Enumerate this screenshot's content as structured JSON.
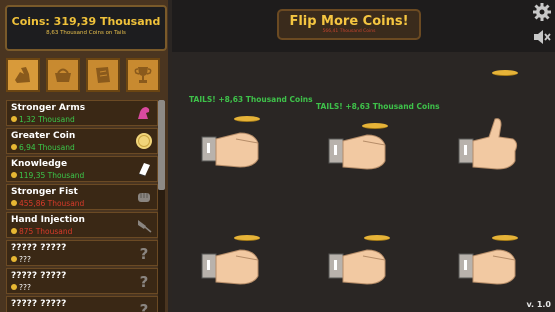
{
  "coins": {
    "total_label": "Coins: 319,39 Thousand",
    "rate_label": "8,63 Thousand Coins on Tails"
  },
  "tabs": [
    {
      "name": "upgrades",
      "icon": "arm-icon"
    },
    {
      "name": "shop",
      "icon": "basket-icon"
    },
    {
      "name": "map",
      "icon": "map-icon"
    },
    {
      "name": "trophies",
      "icon": "trophy-icon"
    }
  ],
  "upgrades": [
    {
      "name": "Stronger Arms",
      "cost": "1,32 Thousand",
      "cost_color": "green",
      "icon": "flexed-arm-icon"
    },
    {
      "name": "Greater Coin",
      "cost": "6,94 Thousand",
      "cost_color": "green",
      "icon": "coin-icon"
    },
    {
      "name": "Knowledge",
      "cost": "119,35 Thousand",
      "cost_color": "green",
      "icon": "book-icon"
    },
    {
      "name": "Stronger Fist",
      "cost": "455,86 Thousand",
      "cost_color": "red",
      "icon": "fist-icon"
    },
    {
      "name": "Hand Injection",
      "cost": "875 Thousand",
      "cost_color": "red",
      "icon": "syringe-icon"
    },
    {
      "name": "????? ?????",
      "cost": "???",
      "cost_color": "white",
      "icon": "question-icon"
    },
    {
      "name": "????? ?????",
      "cost": "???",
      "cost_color": "white",
      "icon": "question-icon"
    },
    {
      "name": "????? ?????",
      "cost": "???",
      "cost_color": "white",
      "icon": "question-icon"
    }
  ],
  "flip_button": {
    "label": "Flip More Coins!",
    "cost": "566,41 Thousand Coins"
  },
  "popups": [
    {
      "text": "TAILS! +8,63 Thousand Coins"
    },
    {
      "text": "TAILS! +8,63 Thousand Coins"
    }
  ],
  "version": "v. 1.0",
  "colors": {
    "gold": "#f5c641",
    "green": "#3cc84a",
    "red": "#d83a2a",
    "panel_brown": "#4a3520",
    "dark_bg": "#2a2624"
  }
}
